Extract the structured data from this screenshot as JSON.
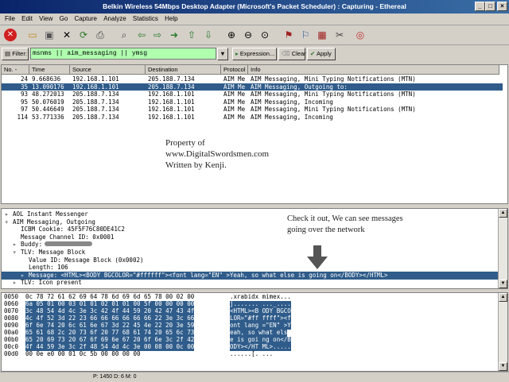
{
  "window": {
    "title": "Belkin Wireless 54Mbps Desktop Adapter (Microsoft's Packet Scheduler) : Capturing - Ethereal"
  },
  "menu": [
    "File",
    "Edit",
    "View",
    "Go",
    "Capture",
    "Analyze",
    "Statistics",
    "Help"
  ],
  "toolbar_icons": [
    "stop-capture-icon",
    "open-icon",
    "save-icon",
    "close-file-icon",
    "reload-icon",
    "print-icon",
    "find-icon",
    "back-icon",
    "forward-icon",
    "go-to-icon",
    "first-packet-icon",
    "last-packet-icon",
    "zoom-in-icon",
    "zoom-out-icon",
    "normal-size-icon",
    "capture-filters-icon",
    "display-filters-icon",
    "coloring-rules-icon",
    "preferences-icon",
    "help-icon"
  ],
  "filter": {
    "label": "Filter:",
    "value": "msnms || aim_messaging || ymsg",
    "expression_label": "Expression...",
    "clear_label": "Clear",
    "apply_label": "Apply"
  },
  "packet_list": {
    "columns": [
      "No. -",
      "Time",
      "Source",
      "Destination",
      "Protocol",
      "Info"
    ],
    "rows": [
      {
        "no": "24",
        "time": "9.668636",
        "src": "192.168.1.101",
        "dst": "205.188.7.134",
        "proto": "AIM Me",
        "info": "AIM Messaging, Mini Typing Notifications (MTN)",
        "selected": false
      },
      {
        "no": "35",
        "time": "13.090176",
        "src": "192.168.1.101",
        "dst": "205.188.7.134",
        "proto": "AIM Me",
        "info": "AIM Messaging, Outgoing to:",
        "selected": true
      },
      {
        "no": "93",
        "time": "48.272013",
        "src": "205.188.7.134",
        "dst": "192.168.1.101",
        "proto": "AIM Me",
        "info": "AIM Messaging, Mini Typing Notifications (MTN)",
        "selected": false
      },
      {
        "no": "95",
        "time": "50.076019",
        "src": "205.188.7.134",
        "dst": "192.168.1.101",
        "proto": "AIM Me",
        "info": "AIM Messaging, Incoming",
        "selected": false
      },
      {
        "no": "97",
        "time": "50.446649",
        "src": "205.188.7.134",
        "dst": "192.168.1.101",
        "proto": "AIM Me",
        "info": "AIM Messaging, Mini Typing Notifications (MTN)",
        "selected": false
      },
      {
        "no": "114",
        "time": "53.771336",
        "src": "205.188.7.134",
        "dst": "192.168.1.101",
        "proto": "AIM Me",
        "info": "AIM Messaging, Incoming",
        "selected": false
      }
    ]
  },
  "watermark": [
    "Property of",
    "www.DigitalSwordsmen.com",
    "Written by Kenji."
  ],
  "annotation": [
    "Check it out, We can see messages",
    "going over the network"
  ],
  "tree": [
    {
      "indent": 0,
      "exp": "▹",
      "text": "AOL Instant Messenger",
      "selected": false
    },
    {
      "indent": 0,
      "exp": "▿",
      "text": "AIM Messaging, Outgoing",
      "selected": false
    },
    {
      "indent": 1,
      "exp": "",
      "text": "ICBM Cookie: 45F5F76C80DE41C2",
      "selected": false
    },
    {
      "indent": 1,
      "exp": "",
      "text": "Message Channel ID: 0x0001",
      "selected": false
    },
    {
      "indent": 1,
      "exp": "▹",
      "text": "Buddy:",
      "selected": false
    },
    {
      "indent": 1,
      "exp": "▿",
      "text": "TLV: Message Block",
      "selected": false
    },
    {
      "indent": 2,
      "exp": "",
      "text": "Value ID: Message Block (0x0002)",
      "selected": false
    },
    {
      "indent": 2,
      "exp": "",
      "text": "Length: 106",
      "selected": false
    },
    {
      "indent": 2,
      "exp": "▹",
      "text": "Message: <HTML><BODY BGCOLOR=\"#ffffff\"><font lang=\"EN\" >Yeah, so what else is going on</BODY></HTML>",
      "selected": true
    },
    {
      "indent": 1,
      "exp": "▹",
      "text": "TLV: Icon present",
      "selected": false
    }
  ],
  "hex": {
    "offsets": [
      "0050",
      "0060",
      "0070",
      "0080",
      "0090",
      "00a0",
      "00b0",
      "00c0",
      "00d0"
    ],
    "bytes": [
      "0c 78 72 61 62 69 64 78  6d 69 6d 65 78 00 02 00",
      "6a 05 01 00 03 01 01 02  01 01 00 5f 00 00 00 00",
      "3c 48 54 4d 4c 3e 3c 42  4f 44 59 20 42 47 43 4f",
      "4c 4f 52 3d 22 23 66 66  66 66 66 66 22 3e 3c 66",
      "6f 6e 74 20 6c 61 6e 67  3d 22 45 4e 22 20 3e 59",
      "65 61 68 2c 20 73 6f 20  77 68 61 74 20 65 6c 73",
      "65 20 69 73 20 67 6f 69  6e 67 20 6f 6e 3c 2f 42",
      "4f 44 59 3e 3c 2f 48 54  4d 4c 3e 00 08 00 0c 00",
      "00 0e e0 00 01 0c 5b 00  00 00 00"
    ],
    "ascii": [
      ".xrabidx mimex...",
      "j.......  ..._....",
      "<HTML><B ODY BGCO",
      "LOR=\"#ff ffff\"><f",
      "ont lang =\"EN\" >Y",
      "eah, so  what els",
      "e is goi ng on</B",
      "ODY></HT ML>.....",
      "......[. ..."
    ]
  },
  "status": {
    "text": "P: 1450 D: 6 M: 0"
  }
}
